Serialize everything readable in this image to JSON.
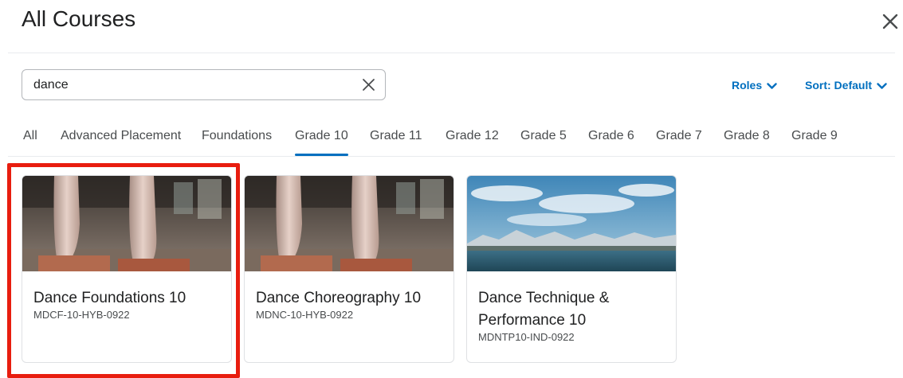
{
  "header": {
    "title": "All Courses"
  },
  "search": {
    "value": "dance"
  },
  "filters": {
    "roles_label": "Roles",
    "sort_label": "Sort: Default"
  },
  "tabs": [
    {
      "label": "All",
      "active": false
    },
    {
      "label": "Advanced Placement",
      "active": false
    },
    {
      "label": "Foundations",
      "active": false
    },
    {
      "label": "Grade 10",
      "active": true
    },
    {
      "label": "Grade 11",
      "active": false
    },
    {
      "label": "Grade 12",
      "active": false
    },
    {
      "label": "Grade 5",
      "active": false
    },
    {
      "label": "Grade 6",
      "active": false
    },
    {
      "label": "Grade 7",
      "active": false
    },
    {
      "label": "Grade 8",
      "active": false
    },
    {
      "label": "Grade 9",
      "active": false
    }
  ],
  "courses": [
    {
      "name": "Dance Foundations 10",
      "code": "MDCF-10-HYB-0922",
      "image": "ballet-pointe-shoes",
      "highlighted": true
    },
    {
      "name": "Dance Choreography 10",
      "code": "MDNC-10-HYB-0922",
      "image": "ballet-pointe-shoes",
      "highlighted": false
    },
    {
      "name": "Dance Technique & Performance 10",
      "code": "MDNTP10-IND-0922",
      "image": "mountain-lake-landscape",
      "highlighted": false
    }
  ],
  "colors": {
    "accent": "#006fbf",
    "highlight_border": "#e81d0f",
    "text": "#202122",
    "muted_text": "#494c4e"
  },
  "icons": {
    "close": "close-icon",
    "clear": "clear-search-icon",
    "dropdown": "chevron-down-icon"
  }
}
